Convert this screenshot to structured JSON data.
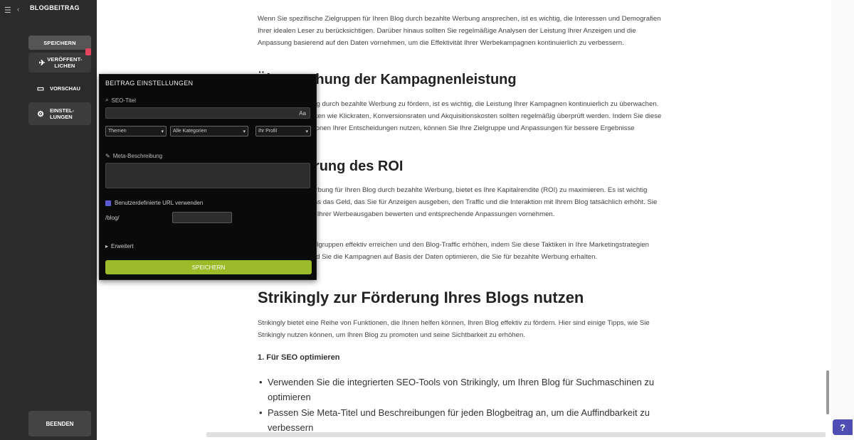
{
  "sidebar": {
    "title": "BLOGBEITRAG",
    "subtitle": "",
    "save_label": "SPEICHERN",
    "publish_label": "VERÖFFENT-\nLICHEN",
    "preview_label": "VORSCHAU",
    "settings_label": "EINSTEL-\nLUNGEN",
    "exit_label": "BEENDEN"
  },
  "popup": {
    "title": "BEITRAG EINSTELLUNGEN",
    "seo_label": "SEO-Titel",
    "title_counter": "Aa",
    "dropdowns": [
      "Themen",
      "Alle Kategorien",
      "Ihr Profil"
    ],
    "meta_label": "Meta-Beschreibung",
    "custom_url_label": "Benutzerdefinierte URL verwenden",
    "url_prefix": "/blog/",
    "advanced_label": "Erweitert",
    "save_button": "SPEICHERN"
  },
  "article": {
    "p1": "Wenn Sie spezifische Zielgruppen für Ihren Blog durch bezahlte Werbung ansprechen, ist es wichtig, die Interessen und Demografien Ihrer idealen Leser zu berücksichtigen. Darüber hinaus sollten Sie regelmäßige Analysen der Leistung Ihrer Anzeigen und die Anpassung basierend auf den Daten vornehmen, um die Effektivität Ihrer Werbekampagnen kontinuierlich zu verbessern.",
    "h_campaign": "Überwachung der Kampagnenleistung",
    "p2": "Wenn Sie Ihren Blog durch bezahlte Werbung zu fördern, ist es wichtig, die Leistung Ihrer Kampagnen kontinuierlich zu überwachen. Die Leistungsmetriken wie Klickraten, Konversionsraten und Akquisitionskosten sollten regelmäßig überprüft werden. Indem Sie diese Daten zur Informationen Ihrer Entscheidungen nutzen, können Sie Ihre Zielgruppe und Anpassungen für bessere Ergebnisse optimieren.",
    "h_roi": "Maximierung des ROI",
    "p3": "Durch bezahlte Werbung für Ihren Blog durch bezahlte Werbung, bietet es Ihre Kapitalrendite (ROI) zu maximieren. Es ist wichtig sicherzustellen, dass das Geld, das Sie für Anzeigen ausgeben, den Traffic und die Interaktion mit Ihrem Blog tatsächlich erhöht. Sie sollten die Wirkung Ihrer Werbeausgaben bewerten und entsprechende Anpassungen vornehmen.",
    "p4": "Sie können Ihre Zielgruppen effektiv erreichen und den Blog-Traffic erhöhen, indem Sie diese Taktiken in Ihre Marketingstrategien integrieren, während Sie die Kampagnen auf Basis der Daten optimieren, die Sie für bezahlte Werbung erhalten.",
    "h_strikingly": "Strikingly zur Förderung Ihres Blogs nutzen",
    "p5": "Strikingly bietet eine Reihe von Funktionen, die Ihnen helfen können, Ihren Blog effektiv zu fördern. Hier sind einige Tipps, wie Sie Strikingly nutzen können, um Ihren Blog zu promoten und seine Sichtbarkeit zu erhöhen.",
    "h_seo": "1. Für SEO optimieren",
    "li1": "Verwenden Sie die integrierten SEO-Tools von Strikingly, um Ihren Blog für Suchmaschinen zu optimieren",
    "li2": "Passen Sie Meta-Titel und Beschreibungen für jeden Blogbeitrag an, um die Auffindbarkeit zu verbessern"
  },
  "help": {
    "label": "?"
  }
}
